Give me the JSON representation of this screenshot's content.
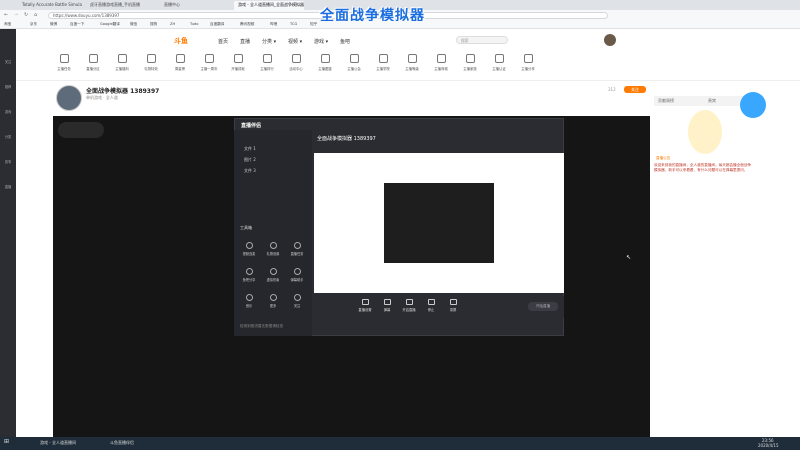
{
  "browser": {
    "tabs": [
      {
        "label": "Totally Accurate Battle Simulator"
      },
      {
        "label": "虎牙直播游戏直播_手机直播"
      },
      {
        "label": "直播中心"
      },
      {
        "label": "游戏 - 全人道直播间_全面战争模拟器"
      }
    ],
    "url": "https://www.douyu.com/1389397",
    "bookmarks": [
      "淘宝",
      "京东",
      "微博",
      "百度一下",
      "Google翻译",
      "微信",
      "搜狗",
      "ZH",
      "Tudo",
      "百度翻译",
      "腾讯视频",
      "哔哩",
      "TCG",
      "知乎"
    ]
  },
  "banner_title": "全面战争模拟器",
  "sidebar": {
    "items": [
      "关注",
      "推荐",
      "游戏",
      "分类",
      "赛事",
      "直播"
    ]
  },
  "site": {
    "logo": "斗鱼",
    "nav": [
      "首页",
      "直播",
      "分类 ▾",
      "视频 ▾",
      "游戏 ▾",
      "鱼吧"
    ],
    "search_placeholder": "搜索"
  },
  "categories": [
    "主播任务",
    "直播分区",
    "主播福利",
    "礼物特效",
    "周星榜",
    "主播一周年",
    "开播成就",
    "主播排行",
    "活动中心",
    "主播图鉴",
    "主播公会",
    "主播学院",
    "主播等级",
    "主播商城",
    "主播家族",
    "主播认证",
    "主播分享"
  ],
  "room": {
    "title": "全面战争模拟器 1389397",
    "meta": "单机游戏 · 全人道",
    "follow_label": "关注",
    "count": "312"
  },
  "obs": {
    "logo": "直播伴侣",
    "scenes": [
      "文件 1",
      "图片 2",
      "文件 3"
    ],
    "source_title": "全面战争模拟器 1389397",
    "tools_label": "工具箱",
    "grid_buttons": [
      "视频连麦",
      "礼物设置",
      "直播任务",
      "鱼吧分享",
      "虚拟形象",
      "弹幕助手",
      "音乐",
      "更多",
      "关注"
    ],
    "toolbar": [
      "直播设置",
      "弹幕",
      "开启直播",
      "停止",
      "录屏"
    ],
    "footer_notice": "检测到推流暂无数据请检查",
    "start_button": "开始直播"
  },
  "right_panel": {
    "tabs": [
      "贡献周榜",
      "贵宾"
    ],
    "announcement_label": "直播公告",
    "announcement": "欢迎来到我的直播间，全人道的直播间。每天都会播全面战争模拟器，新手可以来看看，有什么问题可以在弹幕里提问。"
  },
  "taskbar": {
    "items": [
      "游戏 - 全人道直播间",
      "斗鱼直播伴侣"
    ],
    "time": "23:56",
    "date": "2020/4/15"
  },
  "colors": {
    "accent": "#ff7a00",
    "brand_blue": "#1a6de0"
  }
}
